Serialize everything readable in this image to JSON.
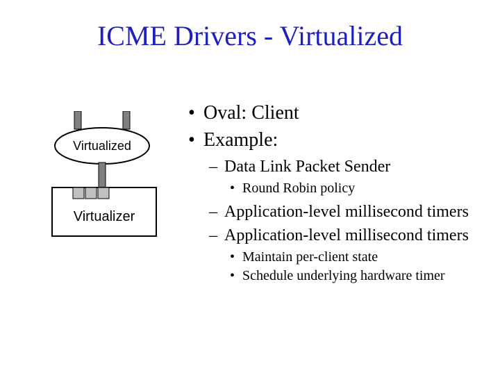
{
  "title": "ICME Drivers - Virtualized",
  "diagram": {
    "oval_label": "Virtualized",
    "box_label": "Virtualizer"
  },
  "bullets": {
    "l1_0": "Oval: Client",
    "l1_1": "Example:",
    "l2_0": "Data Link Packet Sender",
    "l3_0": "Round Robin policy",
    "l2_1": "Application-level millisecond timers",
    "l2_2": "Application-level millisecond timers",
    "l3_1": "Maintain per-client state",
    "l3_2": "Schedule underlying hardware timer"
  }
}
